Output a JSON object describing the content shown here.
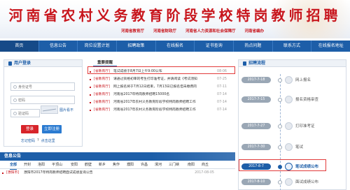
{
  "banner": {
    "title": "河南省农村义务教育阶段学校特岗教师招聘",
    "sub_links": [
      "河南省教育厅",
      "河南省财政厅",
      "河南省人力资源和社会保障厅",
      "河南省编办"
    ]
  },
  "nav": {
    "items": [
      "首页",
      "信息公告",
      "岗位设置计划",
      "招聘政策",
      "在线报名",
      "证书查询",
      "热点问题",
      "联系方式",
      "在线报名地址"
    ],
    "active_index": 0
  },
  "login": {
    "title": "用户登录",
    "username_placeholder": "身份证号",
    "password_placeholder": "密码",
    "captcha_placeholder": "验证码",
    "refresh_label": "图片看不",
    "login_button": "登录",
    "register_button": "立即注册",
    "forgot_label": "忘记密码",
    "separator": "?",
    "find_back": "点击这里"
  },
  "news": {
    "tab": "重要提醒",
    "items": [
      {
        "tag": "[省教育厅]",
        "text": "笔试成绩于8月7日上午9:00公布",
        "date": "08-06"
      },
      {
        "tag": "[省教育厅]",
        "text": "请通过资格初审的考生打印准考证，并请阅读《考试须知》",
        "date": "07-25"
      },
      {
        "tag": "[省教育厅]",
        "text": "网上报名将于7月12日结束，7月13日已报名但未缴费的",
        "date": "07-11"
      },
      {
        "tag": "[省教育厅]",
        "text": "河南省2017年特岗教师招聘15000名",
        "date": "07-14"
      },
      {
        "tag": "[省教育厅]",
        "text": "河南省2017年农村义务教育阶段学校特岗教师招聘工作",
        "date": "07-14"
      },
      {
        "tag": "[省教育厅]",
        "text": "河南省2017年农村义务教育阶段学校特岗教师招聘工作",
        "date": "07-14"
      }
    ]
  },
  "process": {
    "title": "招聘流程",
    "steps": [
      {
        "date": "2017-7-18",
        "label": "网上报名",
        "icon": "computer-icon"
      },
      {
        "date": "2017-7-15",
        "label": "报名资格审查",
        "icon": "search-icon"
      },
      {
        "date": "2017-7-27",
        "label": "打印准考证",
        "icon": "printer-icon"
      },
      {
        "date": "2017-7-30",
        "label": "笔试",
        "icon": "pen-icon"
      },
      {
        "date": "2017-8-7",
        "label": "笔试成绩公布",
        "icon": "pencil-icon"
      },
      {
        "date": "2017-8-10",
        "label": "面试成绩公布",
        "icon": "people-icon"
      }
    ],
    "active_index": 4
  },
  "info": {
    "title": "信息公告",
    "cities": [
      "全部",
      "开封",
      "洛阳",
      "平顶山",
      "安阳",
      "鹤壁",
      "新乡",
      "焦作",
      "濮阳",
      "许昌",
      "漯河",
      "三门峡",
      "南阳",
      "商丘"
    ],
    "active_city_index": 0,
    "items": [
      {
        "tag": "[濮阳市]",
        "text": "濮阳市2017年特岗教师招聘面试成绩查询公告",
        "date": "2017-08-05"
      }
    ]
  },
  "colors": {
    "brand_red": "#c8161d",
    "nav_blue": "#1d5ea8",
    "highlight_red": "#e23b3b"
  }
}
